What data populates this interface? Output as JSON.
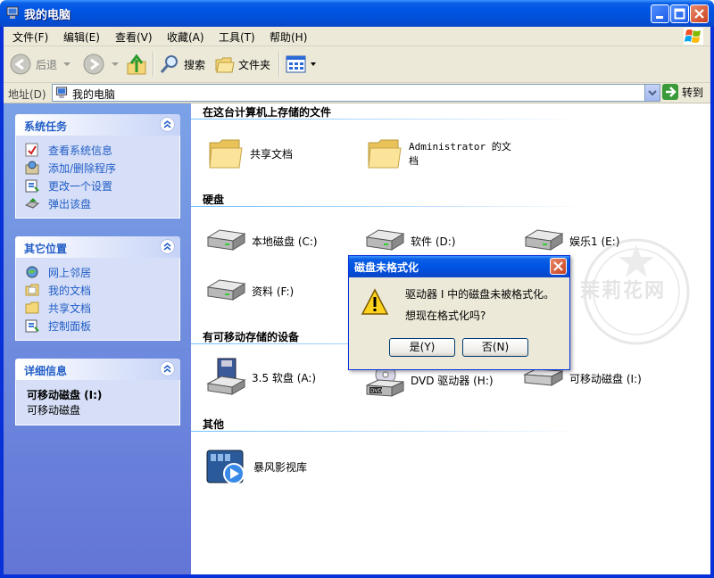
{
  "window": {
    "title": "我的电脑"
  },
  "menu": [
    {
      "label": "文件(F)"
    },
    {
      "label": "编辑(E)"
    },
    {
      "label": "查看(V)"
    },
    {
      "label": "收藏(A)"
    },
    {
      "label": "工具(T)"
    },
    {
      "label": "帮助(H)"
    }
  ],
  "toolbar": {
    "back": "后退",
    "search": "搜索",
    "folders": "文件夹"
  },
  "address": {
    "label": "地址(D)",
    "value": "我的电脑",
    "go": "转到"
  },
  "sidebar": {
    "system_tasks": {
      "title": "系统任务",
      "items": [
        {
          "label": "查看系统信息",
          "icon": "system-info-icon"
        },
        {
          "label": "添加/删除程序",
          "icon": "add-remove-programs-icon"
        },
        {
          "label": "更改一个设置",
          "icon": "change-setting-icon"
        },
        {
          "label": "弹出该盘",
          "icon": "eject-disk-icon"
        }
      ]
    },
    "other_places": {
      "title": "其它位置",
      "items": [
        {
          "label": "网上邻居",
          "icon": "network-places-icon"
        },
        {
          "label": "我的文档",
          "icon": "my-documents-icon"
        },
        {
          "label": "共享文档",
          "icon": "shared-documents-icon"
        },
        {
          "label": "控制面板",
          "icon": "control-panel-icon"
        }
      ]
    },
    "details": {
      "title": "详细信息",
      "name": "可移动磁盘 (I:)",
      "type": "可移动磁盘"
    }
  },
  "main": {
    "groups": {
      "files": {
        "title": "在这台计算机上存储的文件",
        "items": [
          "共享文档",
          "Administrator 的文档"
        ]
      },
      "hard_disks": {
        "title": "硬盘",
        "items": [
          "本地磁盘 (C:)",
          "软件 (D:)",
          "娱乐1 (E:)",
          "资料 (F:)"
        ]
      },
      "removable": {
        "title": "有可移动存储的设备",
        "items": [
          "3.5 软盘 (A:)",
          "DVD 驱动器 (H:)",
          "可移动磁盘 (I:)"
        ]
      },
      "other": {
        "title": "其他",
        "items": [
          "暴风影视库"
        ]
      }
    }
  },
  "dialog": {
    "title": "磁盘未格式化",
    "message1": "驱动器 I 中的磁盘未被格式化。",
    "message2": "想现在格式化吗?",
    "yes": "是(Y)",
    "no": "否(N)"
  },
  "watermark": {
    "brand": "茉莉花网"
  },
  "colors": {
    "title_blue": "#0054e3",
    "pane_blue": "#7ba2e7",
    "link_blue": "#215dc6",
    "chrome": "#ece9d8"
  }
}
